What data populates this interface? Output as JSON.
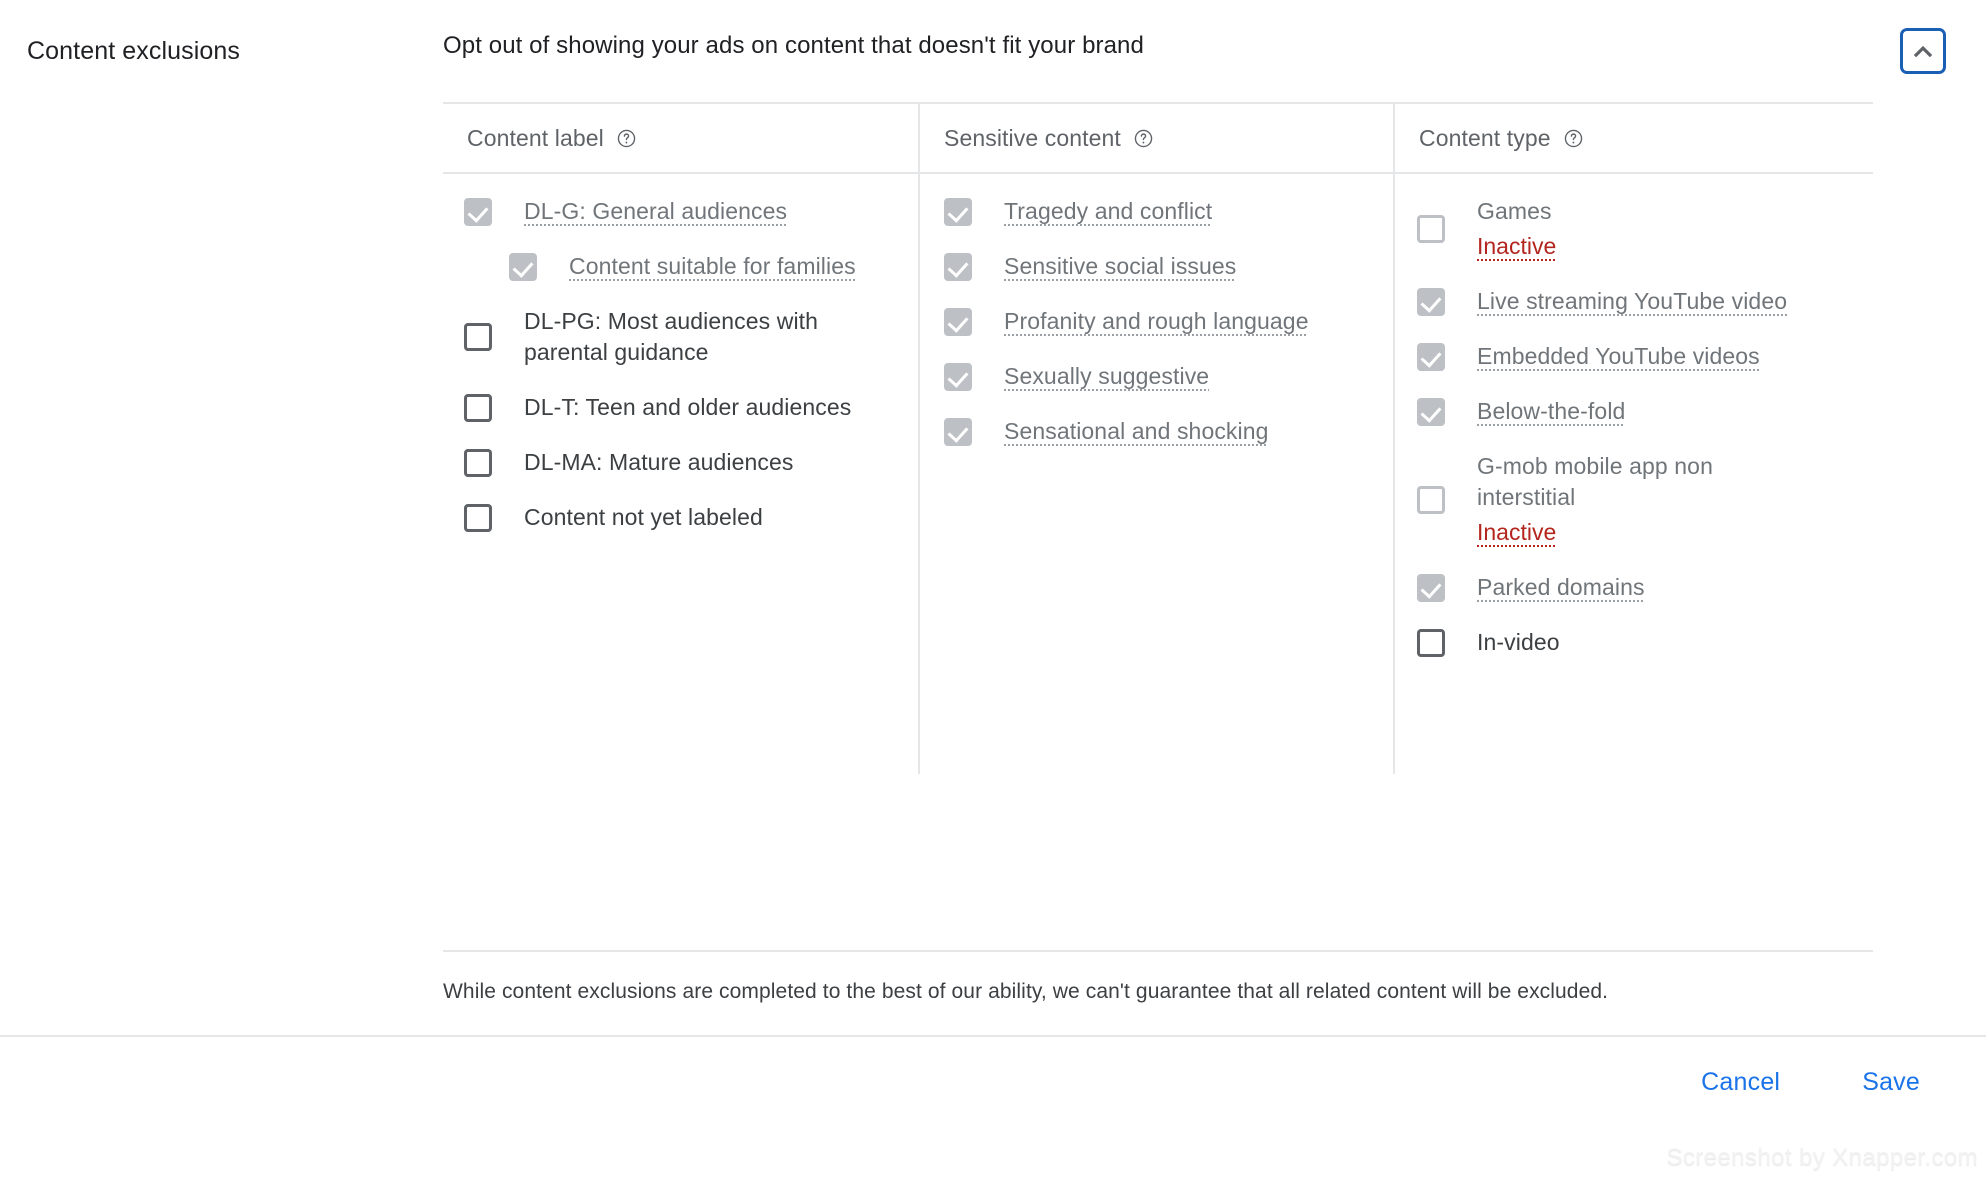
{
  "section": {
    "side_title": "Content exclusions",
    "header_title": "Opt out of showing your ads on content that doesn't fit your brand",
    "collapse_icon": "chevron-up-icon",
    "collapse_accent": "#1a5fb4"
  },
  "columns": [
    {
      "id": "content-label",
      "header": "Content label",
      "help_icon": "help-circle-icon",
      "items": [
        {
          "label": "DL-G: General audiences",
          "checked": true,
          "disabled": true,
          "indent": false,
          "status": null
        },
        {
          "label": "Content suitable for families",
          "checked": true,
          "disabled": true,
          "indent": true,
          "status": null
        },
        {
          "label": "DL-PG: Most audiences with parental guidance",
          "checked": false,
          "disabled": false,
          "indent": false,
          "status": null
        },
        {
          "label": "DL-T: Teen and older audiences",
          "checked": false,
          "disabled": false,
          "indent": false,
          "status": null
        },
        {
          "label": "DL-MA: Mature audiences",
          "checked": false,
          "disabled": false,
          "indent": false,
          "status": null
        },
        {
          "label": "Content not yet labeled",
          "checked": false,
          "disabled": false,
          "indent": false,
          "status": null
        }
      ]
    },
    {
      "id": "sensitive-content",
      "header": "Sensitive content",
      "help_icon": "help-circle-icon",
      "items": [
        {
          "label": "Tragedy and conflict",
          "checked": true,
          "disabled": true,
          "indent": false,
          "status": null
        },
        {
          "label": "Sensitive social issues",
          "checked": true,
          "disabled": true,
          "indent": false,
          "status": null
        },
        {
          "label": "Profanity and rough language",
          "checked": true,
          "disabled": true,
          "indent": false,
          "status": null
        },
        {
          "label": "Sexually suggestive",
          "checked": true,
          "disabled": true,
          "indent": false,
          "status": null
        },
        {
          "label": "Sensational and shocking",
          "checked": true,
          "disabled": true,
          "indent": false,
          "status": null
        }
      ]
    },
    {
      "id": "content-type",
      "header": "Content type",
      "help_icon": "help-circle-icon",
      "items": [
        {
          "label": "Games",
          "checked": false,
          "disabled": true,
          "indent": false,
          "status": "Inactive"
        },
        {
          "label": "Live streaming YouTube video",
          "checked": true,
          "disabled": true,
          "indent": false,
          "status": null
        },
        {
          "label": "Embedded YouTube videos",
          "checked": true,
          "disabled": true,
          "indent": false,
          "status": null
        },
        {
          "label": "Below-the-fold",
          "checked": true,
          "disabled": true,
          "indent": false,
          "status": null
        },
        {
          "label": "G-mob mobile app non interstitial",
          "checked": false,
          "disabled": true,
          "indent": false,
          "status": "Inactive"
        },
        {
          "label": "Parked domains",
          "checked": true,
          "disabled": true,
          "indent": false,
          "status": null
        },
        {
          "label": "In-video",
          "checked": false,
          "disabled": false,
          "indent": false,
          "status": null
        }
      ]
    }
  ],
  "footnote": "While content exclusions are completed to the best of our ability, we can't guarantee that all related content will be excluded.",
  "footer": {
    "cancel_label": "Cancel",
    "save_label": "Save",
    "link_color": "#1a73e8"
  },
  "watermark": "Screenshot by Xnapper.com",
  "status_color": "#b3261e"
}
